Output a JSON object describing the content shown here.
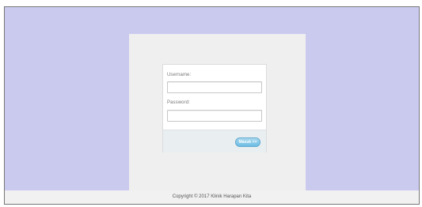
{
  "login": {
    "username_label": "Username:",
    "password_label": "Password:",
    "username_value": "",
    "password_value": "",
    "submit_label": "Masuk >>"
  },
  "footer": {
    "copyright": "Copyright © 2017 Klinik Harapan Kita"
  },
  "colors": {
    "background": "#cacaef",
    "panel": "#efefef",
    "button": "#6cbde4"
  }
}
